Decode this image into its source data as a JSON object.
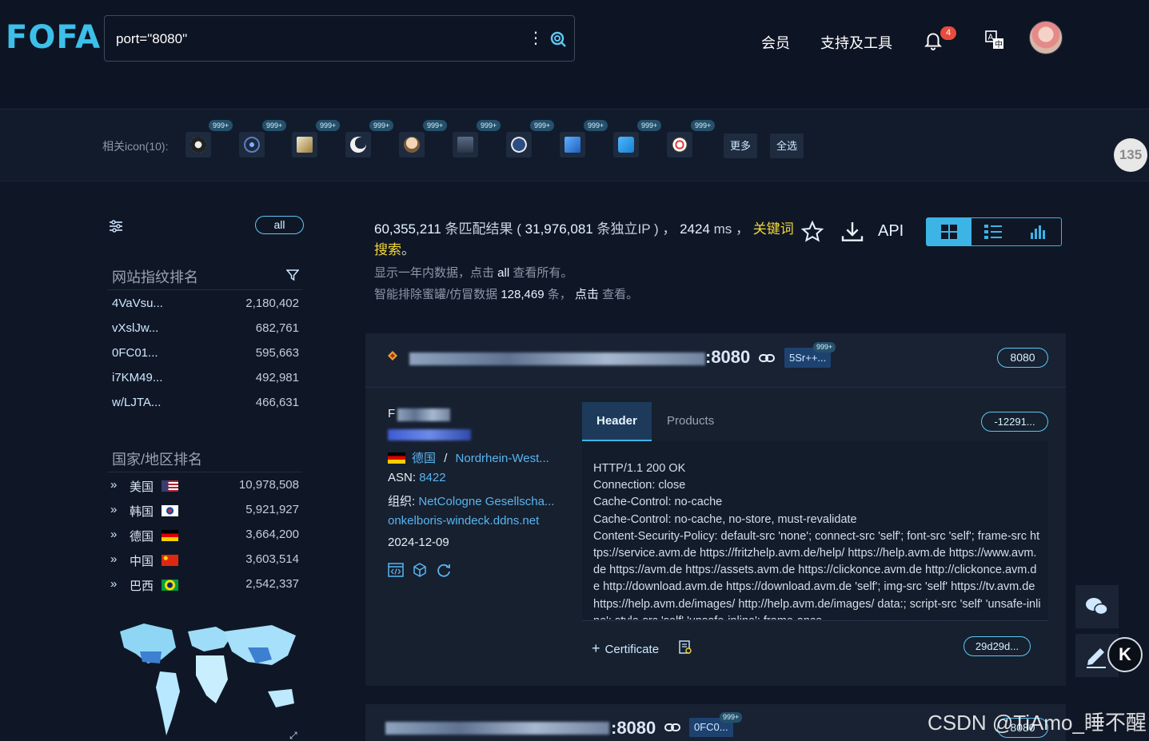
{
  "brand": {
    "logo": "FOFA"
  },
  "search": {
    "query": "port=\"8080\""
  },
  "nav": {
    "member": "会员",
    "tools": "支持及工具",
    "notifications_count": "4"
  },
  "icon_bar": {
    "label": "相关icon(10):",
    "badge": "999+",
    "more_label": "更多",
    "select_all_label": "全选"
  },
  "float_badge": "135",
  "sidebar": {
    "all_label": "all",
    "fingerprint_title": "网站指纹排名",
    "fingerprints": [
      {
        "name": "4VaVsu...",
        "count": "2,180,402"
      },
      {
        "name": "vXslJw...",
        "count": "682,761"
      },
      {
        "name": "0FC01...",
        "count": "595,663"
      },
      {
        "name": "i7KM49...",
        "count": "492,981"
      },
      {
        "name": "w/LJTA...",
        "count": "466,631"
      }
    ],
    "country_title": "国家/地区排名",
    "countries": [
      {
        "name": "美国",
        "count": "10,978,508"
      },
      {
        "name": "韩国",
        "count": "5,921,927"
      },
      {
        "name": "德国",
        "count": "3,664,200"
      },
      {
        "name": "中国",
        "count": "3,603,514"
      },
      {
        "name": "巴西",
        "count": "2,542,337"
      }
    ]
  },
  "summary": {
    "total": "60,355,211",
    "total_suffix": " 条匹配结果 ( ",
    "unique_ip": "31,976,081",
    "unique_suffix": " 条独立IP ) ， ",
    "time": "2424",
    "time_unit": " ms ， ",
    "keyword_search": "关键词搜索",
    "period": "。",
    "note1_prefix": "显示一年内数据，点击 ",
    "note1_link": "all",
    "note1_suffix": " 查看所有。",
    "note2_prefix": "智能排除蜜罐/仿冒数据 ",
    "note2_count": "128,469",
    "note2_mid": " 条，  ",
    "note2_link": "点击",
    "note2_suffix": " 查看。",
    "api_label": "API"
  },
  "result1": {
    "url_tail": ":8080",
    "hash_tag": "5Sr++...",
    "hash_badge": "999+",
    "port": "8080",
    "title_prefix": "F",
    "country": "德国",
    "separator": "/",
    "region": "Nordrhein-West...",
    "asn_label": "ASN: ",
    "asn": "8422",
    "org_label": "组织: ",
    "org": "NetCologne Gesellscha...",
    "domain": "onkelboris-windeck.ddns.net",
    "date": "2024-12-09",
    "tab_header": "Header",
    "tab_products": "Products",
    "header_hash": "-12291...",
    "header_text": "HTTP/1.1 200 OK\nConnection: close\nCache-Control: no-cache\nCache-Control: no-cache, no-store, must-revalidate\nContent-Security-Policy: default-src 'none'; connect-src 'self'; font-src 'self'; frame-src https://service.avm.de https://fritzhelp.avm.de/help/ https://help.avm.de https://www.avm.de https://avm.de https://assets.avm.de https://clickonce.avm.de http://clickonce.avm.de http://download.avm.de https://download.avm.de 'self'; img-src 'self' https://tv.avm.de https://help.avm.de/images/ http://help.avm.de/images/ data:; script-src 'self' 'unsafe-inline'; style-src 'self' 'unsafe-inline'; frame-ance",
    "cert_label": "Certificate",
    "cert_hash": "29d29d..."
  },
  "result2": {
    "url_tail": ":8080",
    "hash_tag": "0FC0...",
    "hash_badge": "999+",
    "port": "8080"
  },
  "watermark": "CSDN @TiAmo_睡不醒"
}
